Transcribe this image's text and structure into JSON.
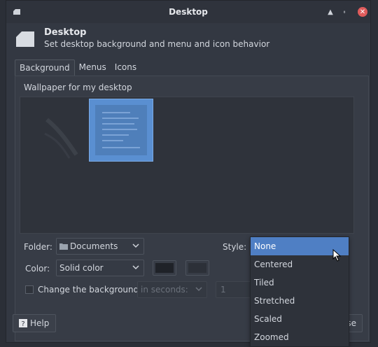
{
  "window": {
    "title": "Desktop",
    "header_title": "Desktop",
    "header_subtitle": "Set desktop background and menu and icon behavior"
  },
  "tabs": [
    {
      "label": "Background",
      "active": true
    },
    {
      "label": "Menus",
      "active": false
    },
    {
      "label": "Icons",
      "active": false
    }
  ],
  "wallpaper": {
    "label": "Wallpaper for my desktop"
  },
  "folder": {
    "label": "Folder:",
    "value": "Documents"
  },
  "style": {
    "label": "Style:",
    "options": [
      "None",
      "Centered",
      "Tiled",
      "Stretched",
      "Scaled",
      "Zoomed"
    ],
    "selected": "None"
  },
  "color": {
    "label": "Color:",
    "value": "Solid color",
    "swatch1": "#1f2228",
    "swatch2": "#2c3038"
  },
  "change_bg": {
    "label": "Change the background",
    "interval_label": "in seconds:",
    "interval_value": "1"
  },
  "buttons": {
    "help": "Help",
    "close_partial": "se"
  },
  "colors": {
    "accent": "#4f7fc4",
    "close": "#e05c5c"
  }
}
